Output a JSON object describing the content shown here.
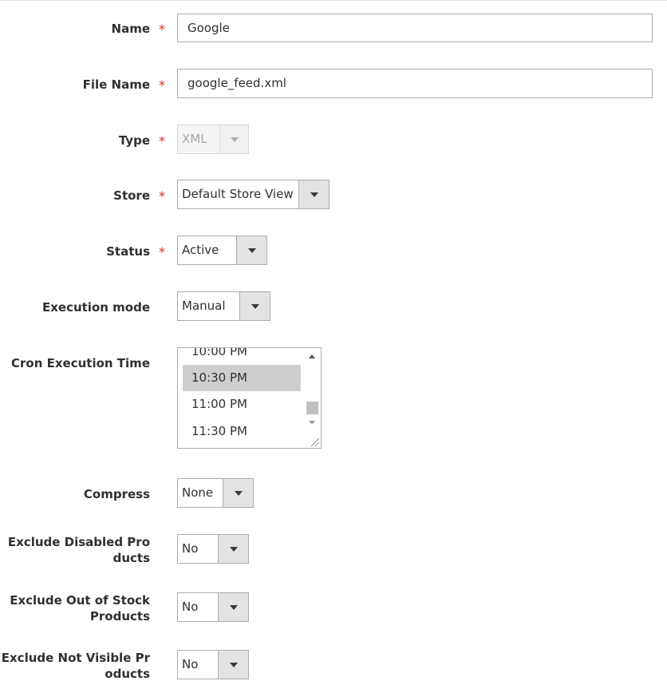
{
  "fields": {
    "name": {
      "label": "Name",
      "required": "*",
      "value": "Google"
    },
    "file_name": {
      "label": "File Name",
      "required": "*",
      "value": "google_feed.xml"
    },
    "type": {
      "label": "Type",
      "required": "*",
      "value": "XML"
    },
    "store": {
      "label": "Store",
      "required": "*",
      "value": "Default Store View"
    },
    "status": {
      "label": "Status",
      "required": "*",
      "value": "Active"
    },
    "execution_mode": {
      "label": "Execution mode",
      "value": "Manual"
    },
    "cron_execution_time": {
      "label": "Cron Execution Time",
      "options": [
        "10:00 PM",
        "10:30 PM",
        "11:00 PM",
        "11:30 PM"
      ],
      "selected": "10:30 PM"
    },
    "compress": {
      "label": "Compress",
      "value": "None"
    },
    "exclude_disabled": {
      "label_line1": "Exclude Disabled Pro",
      "label_line2": "ducts",
      "value": "No"
    },
    "exclude_out_of_stock": {
      "label_line1": "Exclude Out of Stock",
      "label_line2": "Products",
      "value": "No"
    },
    "exclude_not_visible": {
      "label_line1": "Exclude Not Visible Pr",
      "label_line2": "oducts",
      "value": "No"
    }
  },
  "colors": {
    "required": "#e22626",
    "border": "#adadad",
    "arrow_bg": "#e3e3e3",
    "selected_option": "#cecece"
  }
}
